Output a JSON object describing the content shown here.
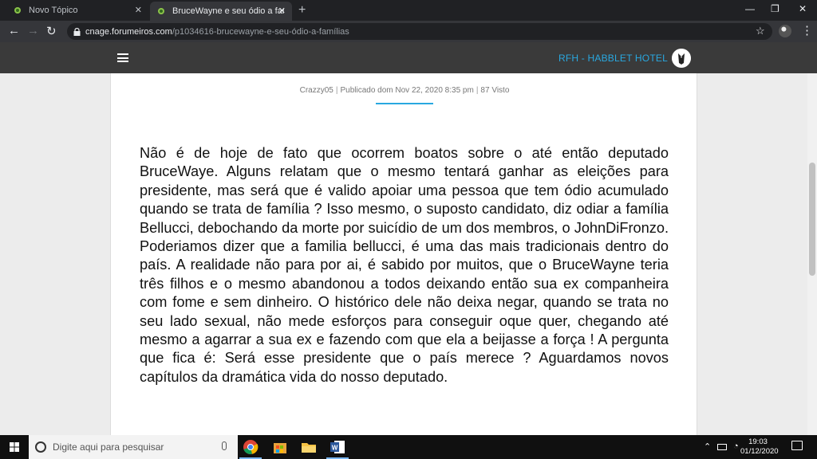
{
  "browser": {
    "tabs": [
      {
        "title": "Novo Tópico",
        "active": false
      },
      {
        "title": "BruceWayne e seu ódio a famílias",
        "active": true
      }
    ],
    "url_host": "cnage.forumeiros.com",
    "url_path": "/p1034616-brucewayne-e-seu-ódio-a-famílias"
  },
  "site": {
    "title": "RFH - HABBLET HOTEL",
    "accent_color": "#29a8e0"
  },
  "post": {
    "author": "Crazzy05",
    "published": "Publicado dom Nov 22, 2020 8:35 pm",
    "views": "87 Visto",
    "body": "Não é de hoje de fato que ocorrem boatos sobre o até então deputado BruceWaye. Alguns relatam que o mesmo tentará ganhar as eleições para presidente, mas será que é valido apoiar uma pessoa que tem ódio acumulado quando se trata de família ? Isso mesmo, o suposto candidato, diz odiar a família Bellucci, debochando da morte por suicídio de um dos membros, o JohnDiFronzo. Poderiamos dizer que a familia bellucci, é uma das mais tradicionais dentro do país. A realidade não para por ai, é sabido por muitos, que o BruceWayne teria três filhos e o mesmo abandonou a todos deixando então sua ex companheira com fome e sem dinheiro. O histórico dele não deixa negar, quando se trata no seu lado sexual, não mede esforços para conseguir oque quer, chegando até mesmo a agarrar a sua ex e fazendo com que ela a beijasse a força ! A pergunta que fica é: Será esse presidente que o país merece ? Aguardamos novos capítulos da dramática vida do nosso deputado."
  },
  "taskbar": {
    "search_placeholder": "Digite aqui para pesquisar",
    "time": "19:03",
    "date": "01/12/2020",
    "apps": [
      "chrome-icon",
      "store-icon",
      "file-explorer-icon",
      "word-icon"
    ]
  }
}
